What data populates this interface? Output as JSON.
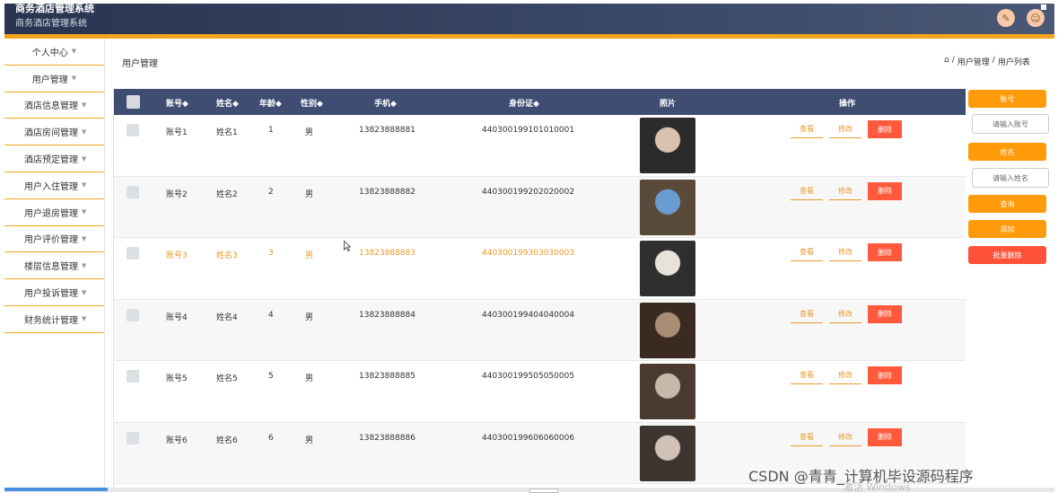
{
  "header": {
    "title_top": "商务酒店管理系统",
    "title": "商务酒店管理系统",
    "icon_left": "pencil-icon",
    "icon_right": "user-icon"
  },
  "sidebar": {
    "items": [
      {
        "label": "个人中心"
      },
      {
        "label": "用户管理"
      },
      {
        "label": "酒店信息管理"
      },
      {
        "label": "酒店房间管理"
      },
      {
        "label": "酒店预定管理"
      },
      {
        "label": "用户入住管理"
      },
      {
        "label": "用户退房管理"
      },
      {
        "label": "用户评价管理"
      },
      {
        "label": "楼层信息管理"
      },
      {
        "label": "用户投诉管理"
      },
      {
        "label": "财务统计管理"
      }
    ]
  },
  "page": {
    "title": "用户管理",
    "breadcrumb": [
      "⌂",
      "/",
      "用户管理",
      "/",
      "用户列表"
    ]
  },
  "table": {
    "headers": [
      "账号◆",
      "姓名◆",
      "年龄◆",
      "性别◆",
      "手机◆",
      "身份证◆",
      "照片",
      "操作"
    ],
    "action_labels": {
      "view": "查看",
      "edit": "修改",
      "delete": "删除"
    },
    "rows": [
      {
        "account": "账号1",
        "name": "姓名1",
        "age": "1",
        "gender": "男",
        "phone": "13823888881",
        "id_card": "440300199101010001"
      },
      {
        "account": "账号2",
        "name": "姓名2",
        "age": "2",
        "gender": "男",
        "phone": "13823888882",
        "id_card": "440300199202020002"
      },
      {
        "account": "账号3",
        "name": "姓名3",
        "age": "3",
        "gender": "男",
        "phone": "13823888883",
        "id_card": "440300199303030003"
      },
      {
        "account": "账号4",
        "name": "姓名4",
        "age": "4",
        "gender": "男",
        "phone": "13823888884",
        "id_card": "440300199404040004"
      },
      {
        "account": "账号5",
        "name": "姓名5",
        "age": "5",
        "gender": "男",
        "phone": "13823888885",
        "id_card": "440300199505050005"
      },
      {
        "account": "账号6",
        "name": "姓名6",
        "age": "6",
        "gender": "男",
        "phone": "13823888886",
        "id_card": "440300199606060006"
      }
    ]
  },
  "right_panel": {
    "account_label": "账号",
    "account_placeholder": "请输入账号",
    "name_label": "姓名",
    "name_placeholder": "请输入姓名",
    "search_button": "查询",
    "add_button": "添加",
    "batch_delete_button": "批量删除"
  },
  "footer": {
    "watermark": "CSDN @青青_计算机毕设源码程序",
    "windows_mark": "激活 Windows"
  },
  "colors": {
    "header_bg": "#293450",
    "accent": "#f2a51a",
    "table_header": "#3f4d73",
    "orange_button": "#ff9a0a",
    "delete_red": "#ff5a3c",
    "highlight_text": "#e89a2c"
  }
}
